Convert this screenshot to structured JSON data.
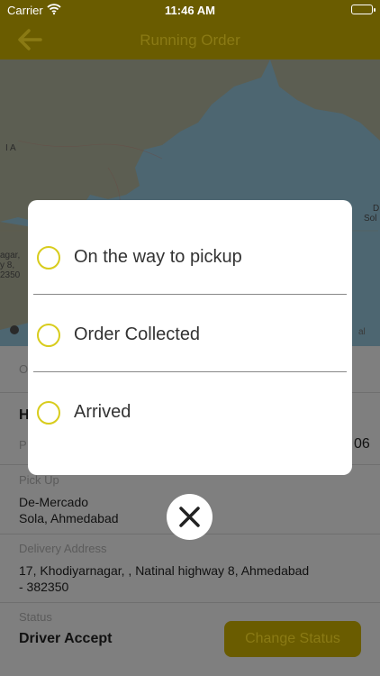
{
  "status_bar": {
    "carrier": "Carrier",
    "time": "11:46 AM"
  },
  "nav": {
    "title": "Running Order"
  },
  "map": {
    "labels": {
      "ia": "I A",
      "left_address": "agar,",
      "left_address2": "y 8,",
      "left_address3": "2350",
      "right_de": "D",
      "right_sol": "Sol",
      "legal": "al"
    }
  },
  "details": {
    "order_label": "O",
    "heading_initial": "H",
    "p_label": "P",
    "amount_suffix": "06",
    "pickup_label": "Pick Up",
    "pickup_line1": "De-Mercado",
    "pickup_line2": "Sola, Ahmedabad",
    "delivery_label": "Delivery Address",
    "delivery_line1": "17, Khodiyarnagar, , Natinal highway 8, Ahmedabad",
    "delivery_line2": "- 382350",
    "status_label": "Status",
    "status_value": "Driver Accept",
    "change_status_label": "Change Status"
  },
  "dialog": {
    "options": [
      {
        "label": "On the way to pickup",
        "selected": false
      },
      {
        "label": "Order Collected",
        "selected": false
      },
      {
        "label": "Arrived",
        "selected": false
      }
    ]
  },
  "colors": {
    "accent": "#d8cc1c",
    "nav_dim": "#6a5c00"
  }
}
